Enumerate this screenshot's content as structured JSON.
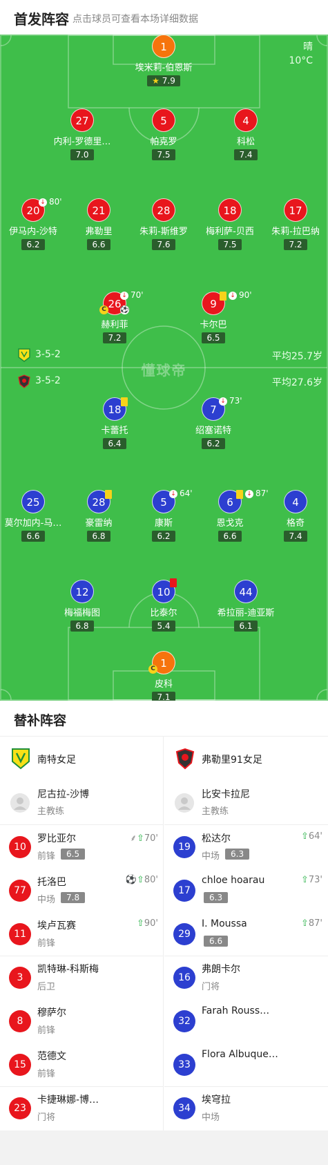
{
  "header": {
    "title": "首发阵容",
    "hint": "点击球员可查看本场详细数据"
  },
  "weather": {
    "condition": "晴",
    "temp": "10°C"
  },
  "watermark": "懂球帝",
  "home_formation": {
    "formation": "3-5-2",
    "avg_age": "平均25.7岁"
  },
  "away_formation": {
    "formation": "3-5-2",
    "avg_age": "平均27.6岁"
  },
  "home_players": [
    {
      "num": "1",
      "name": "埃米莉-伯恩斯",
      "rating": "7.9",
      "star": "★"
    },
    {
      "num": "27",
      "name": "内利-罗德里…",
      "rating": "7.0"
    },
    {
      "num": "5",
      "name": "帕克罗",
      "rating": "7.5"
    },
    {
      "num": "4",
      "name": "科松",
      "rating": "7.4"
    },
    {
      "num": "20",
      "name": "伊马内-沙特",
      "rating": "6.2",
      "sub": "80'"
    },
    {
      "num": "21",
      "name": "弗勒里",
      "rating": "6.6"
    },
    {
      "num": "28",
      "name": "朱莉-斯维罗",
      "rating": "7.6"
    },
    {
      "num": "18",
      "name": "梅利萨-贝西",
      "rating": "7.5"
    },
    {
      "num": "17",
      "name": "朱莉-拉巴纳",
      "rating": "7.2"
    },
    {
      "num": "26",
      "name": "赫利菲",
      "rating": "7.2",
      "sub": "70'",
      "captain": "C"
    },
    {
      "num": "9",
      "name": "卡尔巴",
      "rating": "6.5",
      "sub": "90'"
    }
  ],
  "away_players": [
    {
      "num": "18",
      "name": "卡蕾托",
      "rating": "6.4"
    },
    {
      "num": "7",
      "name": "绍塞诺特",
      "rating": "6.2",
      "sub": "73'"
    },
    {
      "num": "25",
      "name": "莫尔加内-马…",
      "rating": "6.6"
    },
    {
      "num": "28",
      "name": "豪雷纳",
      "rating": "6.8"
    },
    {
      "num": "5",
      "name": "康斯",
      "rating": "6.2",
      "sub": "64'"
    },
    {
      "num": "6",
      "name": "恩戈克",
      "rating": "6.6",
      "sub": "87'"
    },
    {
      "num": "4",
      "name": "格奇",
      "rating": "7.4"
    },
    {
      "num": "12",
      "name": "梅福梅图",
      "rating": "6.8"
    },
    {
      "num": "10",
      "name": "比泰尔",
      "rating": "5.4"
    },
    {
      "num": "44",
      "name": "希拉丽-迪亚斯",
      "rating": "6.1"
    },
    {
      "num": "1",
      "name": "皮科",
      "rating": "7.1",
      "captain": "C"
    }
  ],
  "subs": {
    "title": "替补阵容",
    "home": {
      "team": "南特女足",
      "coach": {
        "name": "尼古拉-沙博",
        "role": "主教练"
      },
      "players": [
        {
          "num": "10",
          "name": "罗比亚尔",
          "pos": "前锋",
          "rating": "6.5",
          "in": "70'"
        },
        {
          "num": "77",
          "name": "托洛巴",
          "pos": "中场",
          "rating": "7.8",
          "in": "80'"
        },
        {
          "num": "11",
          "name": "埃卢瓦赛",
          "pos": "前锋",
          "in": "90'"
        },
        {
          "num": "3",
          "name": "凯特琳-科斯梅",
          "pos": "后卫"
        },
        {
          "num": "8",
          "name": "穆萨尔",
          "pos": "前锋"
        },
        {
          "num": "15",
          "name": "范德文",
          "pos": "前锋"
        },
        {
          "num": "23",
          "name": "卡捷琳娜-博…",
          "pos": "门将"
        }
      ]
    },
    "away": {
      "team": "弗勒里91女足",
      "coach": {
        "name": "比安卡拉尼",
        "role": "主教练"
      },
      "players": [
        {
          "num": "19",
          "name": "松达尔",
          "pos": "中场",
          "rating": "6.3",
          "in": "64'"
        },
        {
          "num": "17",
          "name": "chloe hoarau",
          "pos": "",
          "rating": "6.3",
          "in": "73'"
        },
        {
          "num": "29",
          "name": "I. Moussa",
          "pos": "",
          "rating": "6.6",
          "in": "87'"
        },
        {
          "num": "16",
          "name": "弗朗卡尔",
          "pos": "门将"
        },
        {
          "num": "32",
          "name": "Farah Rouss…",
          "pos": ""
        },
        {
          "num": "33",
          "name": "Flora Albuque…",
          "pos": ""
        },
        {
          "num": "34",
          "name": "埃穹拉",
          "pos": "中场"
        }
      ]
    }
  },
  "icons": {
    "sub_in": "arrow-up-icon",
    "sub_out": "arrow-down-icon",
    "goal": "ball-icon",
    "assist": "boot-icon"
  },
  "colors": {
    "home": "#e8161d",
    "home_gk": "#f6740c",
    "away": "#2c3fd0",
    "pitch": "#3fbe4a"
  }
}
